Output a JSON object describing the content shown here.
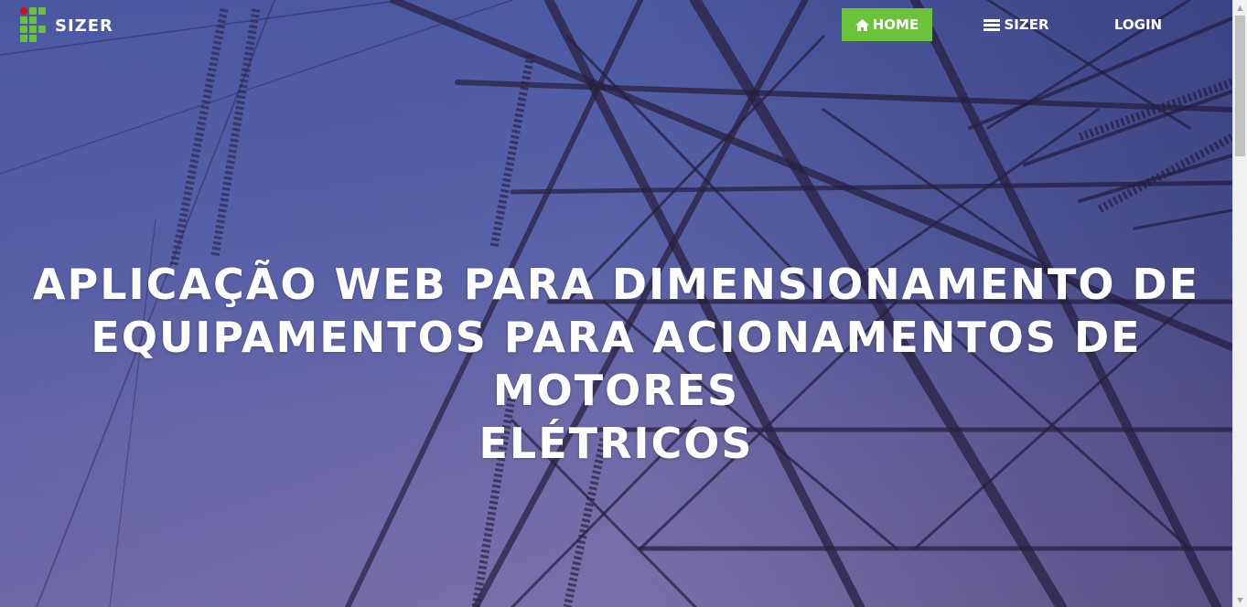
{
  "brand": {
    "name": "SIZER",
    "logo_colors": {
      "cells": "#6ac23c",
      "dot": "#c4161c"
    }
  },
  "nav": {
    "home_label": "HOME",
    "sizer_label": "SIZER",
    "login_label": "LOGIN",
    "home_icon": "home-icon",
    "sizer_icon": "list-icon",
    "active_color": "#6dc23b"
  },
  "hero": {
    "line1": "APLICAÇÃO WEB PARA DIMENSIONAMENTO DE",
    "line2": "EQUIPAMENTOS PARA ACIONAMENTOS DE MOTORES",
    "line3": "ELÉTRICOS"
  }
}
